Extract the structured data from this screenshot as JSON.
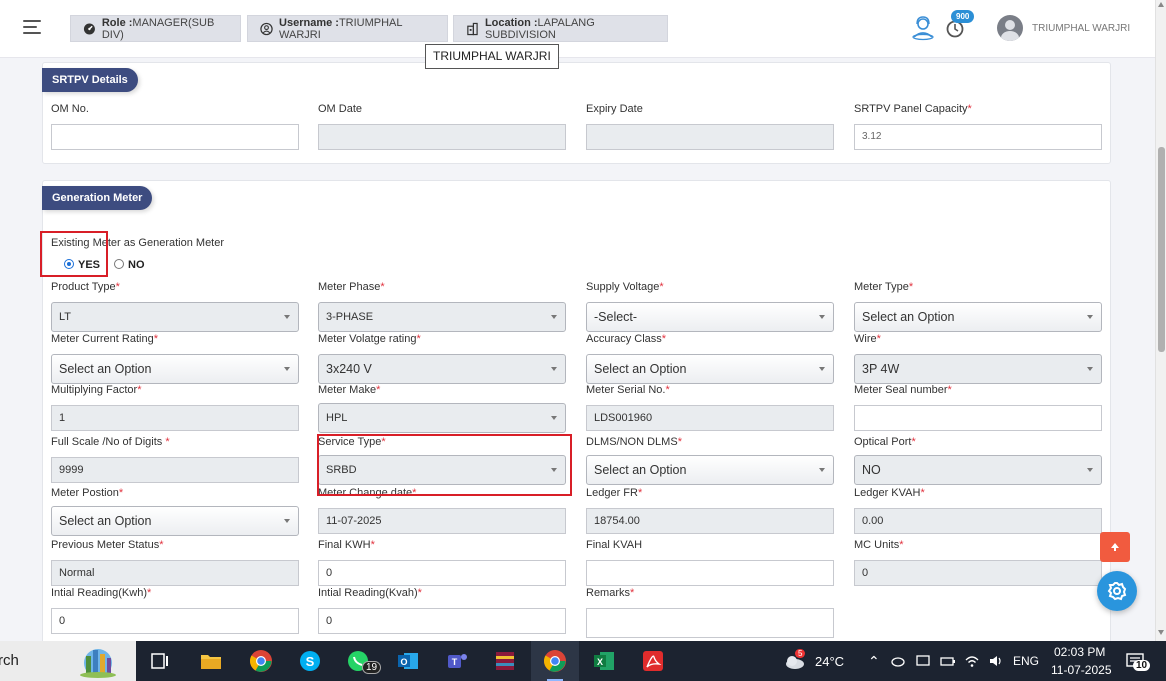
{
  "header": {
    "role_label": "Role :",
    "role_value": "MANAGER(SUB DIV)",
    "username_label": "Username :",
    "username_value": "TRIUMPHAL WARJRI",
    "location_label": "Location :",
    "location_value": "LAPALANG SUBDIVISION",
    "tooltip": "TRIUMPHAL WARJRI",
    "notification_count": "900",
    "user_name": "TRIUMPHAL WARJRI"
  },
  "srtpv": {
    "title": "SRTPV Details",
    "om_no_label": "OM No.",
    "om_no_value": "",
    "om_date_label": "OM Date",
    "om_date_value": "",
    "expiry_label": "Expiry Date",
    "expiry_value": "",
    "capacity_label": "SRTPV Panel Capacity",
    "capacity_value": "3.12"
  },
  "gen": {
    "title": "Generation Meter",
    "existing_label": "Existing Meter as Generation Meter",
    "yes_label": "YES",
    "no_label": "NO",
    "product_type_label": "Product Type",
    "product_type_value": "LT",
    "meter_phase_label": "Meter Phase",
    "meter_phase_value": "3-PHASE",
    "supply_voltage_label": "Supply Voltage",
    "supply_voltage_value": "-Select-",
    "meter_type_label": "Meter Type",
    "meter_type_value": "Select an Option",
    "current_rating_label": "Meter Current Rating",
    "current_rating_value": "Select an Option",
    "voltage_rating_label": "Meter Volatge rating",
    "voltage_rating_value": "3x240 V",
    "accuracy_label": "Accuracy Class",
    "accuracy_value": "Select an Option",
    "wire_label": "Wire",
    "wire_value": "3P 4W",
    "mf_label": "Multiplying Factor",
    "mf_value": "1",
    "make_label": "Meter Make",
    "make_value": "HPL",
    "serial_label": "Meter Serial No.",
    "serial_value": "LDS001960",
    "seal_label": "Meter Seal number",
    "seal_value": "",
    "fullscale_label": "Full Scale /No of Digits",
    "fullscale_value": "9999",
    "service_type_label": "Service Type",
    "service_type_value": "SRBD",
    "dlms_label": "DLMS/NON DLMS",
    "dlms_value": "Select an Option",
    "optical_label": "Optical Port",
    "optical_value": "NO",
    "position_label": "Meter Postion",
    "position_value": "Select an Option",
    "change_date_label": "Meter Change date",
    "change_date_value": "11-07-2025",
    "ledger_fr_label": "Ledger FR",
    "ledger_fr_value": "18754.00",
    "ledger_kvah_label": "Ledger KVAH",
    "ledger_kvah_value": "0.00",
    "prev_status_label": "Previous Meter Status",
    "prev_status_value": "Normal",
    "final_kwh_label": "Final KWH",
    "final_kwh_value": "0",
    "final_kvah_label": "Final KVAH",
    "final_kvah_value": "",
    "mc_units_label": "MC Units",
    "mc_units_value": "0",
    "init_kwh_label": "Intial Reading(Kwh)",
    "init_kwh_value": "0",
    "init_kvah_label": "Intial Reading(Kvah)",
    "init_kvah_value": "0",
    "remarks_label": "Remarks",
    "remarks_value": ""
  },
  "taskbar": {
    "search_text": "rch",
    "whatsapp_badge": "19",
    "weather_badge": "5",
    "temperature": "24°C",
    "language": "ENG",
    "time": "02:03 PM",
    "date": "11-07-2025",
    "notifications": "10"
  },
  "colors": {
    "section_tag": "#3d4c80",
    "required": "#e1323e",
    "highlight": "#d81e27",
    "scroll_top": "#f15b3f",
    "settings": "#2a95dd"
  }
}
